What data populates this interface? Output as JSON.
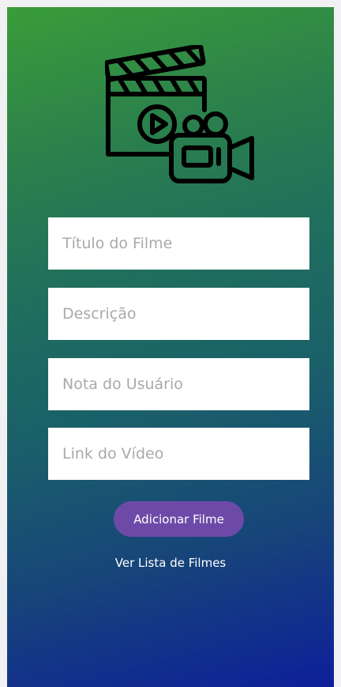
{
  "logo": {
    "icon": "clapperboard-video-camera-icon"
  },
  "form": {
    "fields": [
      {
        "placeholder": "Título do Filme",
        "value": ""
      },
      {
        "placeholder": "Descrição",
        "value": ""
      },
      {
        "placeholder": "Nota do Usuário",
        "value": ""
      },
      {
        "placeholder": "Link do Vídeo",
        "value": ""
      }
    ],
    "submit_label": "Adicionar Filme",
    "list_link_label": "Ver Lista de Filmes"
  },
  "colors": {
    "gradient_top": "#3a9c39",
    "gradient_bottom": "#0d1f9a",
    "button": "#6e4aa8",
    "field_bg": "#ffffff"
  }
}
